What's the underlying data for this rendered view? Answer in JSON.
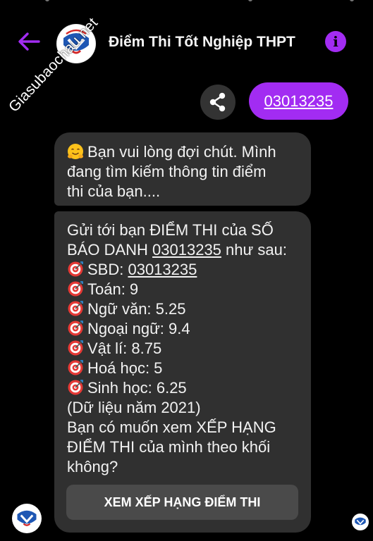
{
  "header": {
    "title": "Điểm Thi Tốt Nghiệp THPT",
    "info_glyph": "i"
  },
  "watermark": "Giasubaochau.net",
  "sent_message": "03013235",
  "messages": {
    "waiting": [
      "Bạn vui lòng đợi chút. Mình",
      "đang tìm kiếm thông tin điểm",
      "thi của bạn...."
    ],
    "result_intro_1": "Gửi tới bạn ĐIỂM THI của SỐ",
    "result_intro_2_prefix": "BÁO DANH ",
    "result_intro_2_sbd": "03013235",
    "result_intro_2_suffix": " như sau:",
    "sbd_label": "SBD: ",
    "sbd_value": "03013235",
    "scores": [
      "Toán: 9",
      "Ngữ văn: 5.25",
      "Ngoại ngữ: 9.4",
      "Vật lí: 8.75",
      "Hoá học: 5",
      "Sinh học: 6.25"
    ],
    "year_note": "(Dữ liệu năm 2021)",
    "question": [
      "Bạn có muốn xem XẾP HẠNG",
      "ĐIỂM THI của mình theo khối",
      "không?"
    ],
    "button": "XEM XẾP HẠNG ĐIỂM THI"
  },
  "colors": {
    "accent": "#a22cf2",
    "bubble": "#303030",
    "button": "#4a4a4a"
  },
  "icons": [
    "back-arrow-icon",
    "info-icon",
    "share-icon",
    "hugging-face-emoji-icon",
    "direct-hit-emoji-icon"
  ]
}
